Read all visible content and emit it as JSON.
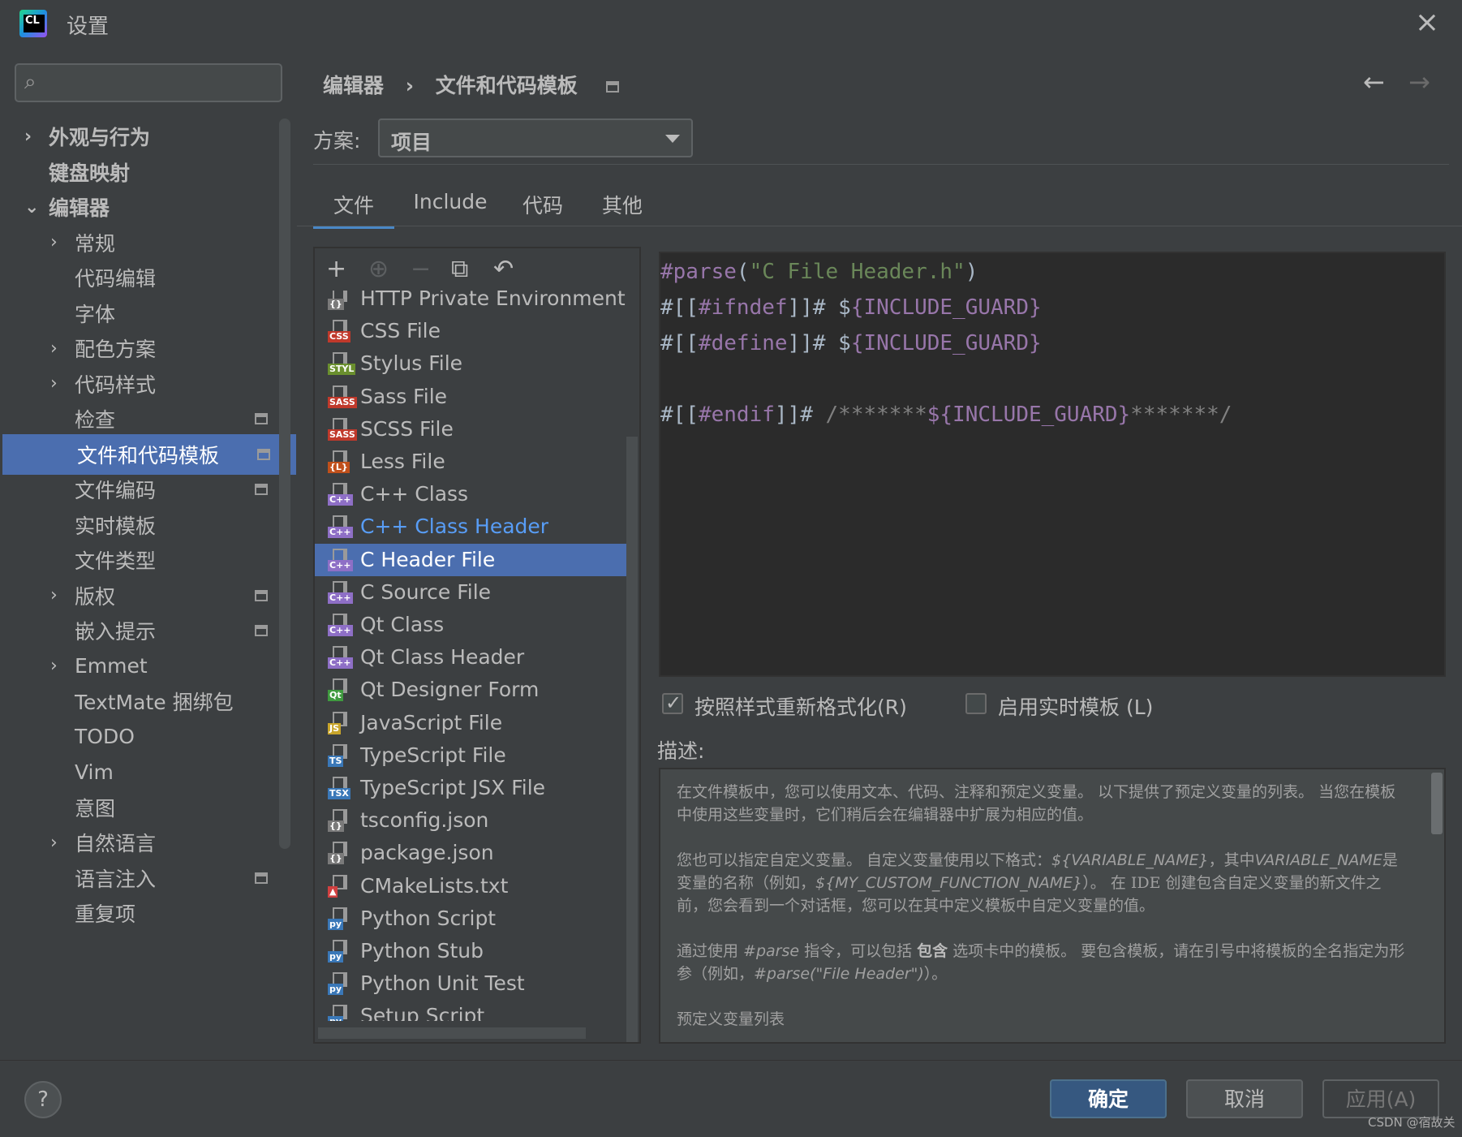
{
  "window": {
    "title": "设置",
    "close_icon": "×"
  },
  "search": {
    "placeholder": ""
  },
  "sidebar": {
    "items": [
      {
        "label": "外观与行为",
        "arrow": "›",
        "bold": true
      },
      {
        "label": "键盘映射",
        "arrow": "",
        "bold": true
      },
      {
        "label": "编辑器",
        "arrow": "⌄",
        "bold": true
      },
      {
        "label": "常规",
        "arrow": "›"
      },
      {
        "label": "代码编辑",
        "arrow": ""
      },
      {
        "label": "字体",
        "arrow": ""
      },
      {
        "label": "配色方案",
        "arrow": "›"
      },
      {
        "label": "代码样式",
        "arrow": "›"
      },
      {
        "label": "检查",
        "arrow": ""
      },
      {
        "label": "文件和代码模板",
        "arrow": ""
      },
      {
        "label": "文件编码",
        "arrow": ""
      },
      {
        "label": "实时模板",
        "arrow": ""
      },
      {
        "label": "文件类型",
        "arrow": ""
      },
      {
        "label": "版权",
        "arrow": "›"
      },
      {
        "label": "嵌入提示",
        "arrow": ""
      },
      {
        "label": "Emmet",
        "arrow": "›"
      },
      {
        "label": "TextMate 捆绑包",
        "arrow": ""
      },
      {
        "label": "TODO",
        "arrow": ""
      },
      {
        "label": "Vim",
        "arrow": ""
      },
      {
        "label": "意图",
        "arrow": ""
      },
      {
        "label": "自然语言",
        "arrow": "›"
      },
      {
        "label": "语言注入",
        "arrow": ""
      },
      {
        "label": "重复项",
        "arrow": ""
      }
    ]
  },
  "breadcrumb": {
    "parent": "编辑器",
    "separator": "›",
    "current": "文件和代码模板"
  },
  "nav": {
    "back": "←",
    "forward": "→"
  },
  "scheme": {
    "label": "方案:",
    "value": "项目"
  },
  "tabs": [
    "文件",
    "Include",
    "代码",
    "其他"
  ],
  "toolbar": {
    "add": "+",
    "add_child": "⊕",
    "remove": "−",
    "copy": "⧉",
    "reset": "↶"
  },
  "files": [
    {
      "name": "HTTP Private Environment File",
      "badge": "{}",
      "color": "#7a7a7a"
    },
    {
      "name": "CSS File",
      "badge": "CSS",
      "color": "#c0392b"
    },
    {
      "name": "Stylus File",
      "badge": "STYL",
      "color": "#6a8f2e"
    },
    {
      "name": "Sass File",
      "badge": "SASS",
      "color": "#c0392b"
    },
    {
      "name": "SCSS File",
      "badge": "SASS",
      "color": "#c0392b"
    },
    {
      "name": "Less File",
      "badge": "{L}",
      "color": "#c0501b"
    },
    {
      "name": "C++ Class",
      "badge": "C++",
      "color": "#8e6fc6"
    },
    {
      "name": "C++ Class Header",
      "badge": "C++",
      "color": "#8e6fc6"
    },
    {
      "name": "C Header File",
      "badge": "C++",
      "color": "#8e6fc6"
    },
    {
      "name": "C Source File",
      "badge": "C++",
      "color": "#8e6fc6"
    },
    {
      "name": "Qt Class",
      "badge": "C++",
      "color": "#8e6fc6"
    },
    {
      "name": "Qt Class Header",
      "badge": "C++",
      "color": "#8e6fc6"
    },
    {
      "name": "Qt Designer Form",
      "badge": "Qt",
      "color": "#3f9a3f"
    },
    {
      "name": "JavaScript File",
      "badge": "JS",
      "color": "#c8a52b"
    },
    {
      "name": "TypeScript File",
      "badge": "TS",
      "color": "#3a78b8"
    },
    {
      "name": "TypeScript JSX File",
      "badge": "TSX",
      "color": "#3a78b8"
    },
    {
      "name": "tsconfig.json",
      "badge": "{}",
      "color": "#7a7a7a"
    },
    {
      "name": "package.json",
      "badge": "{}",
      "color": "#7a7a7a"
    },
    {
      "name": "CMakeLists.txt",
      "badge": "▲",
      "color": "#d04040"
    },
    {
      "name": "Python Script",
      "badge": "py",
      "color": "#3a78b8"
    },
    {
      "name": "Python Stub",
      "badge": "py",
      "color": "#3a78b8"
    },
    {
      "name": "Python Unit Test",
      "badge": "py",
      "color": "#3a78b8"
    },
    {
      "name": "Setup Script",
      "badge": "py",
      "color": "#3a78b8"
    }
  ],
  "editor": {
    "lines": [
      "#parse(\"C File Header.h\")",
      "#[[#ifndef]]# ${INCLUDE_GUARD}",
      "#[[#define]]# ${INCLUDE_GUARD}",
      "",
      "#[[#endif]]# /*******${INCLUDE_GUARD}*******/"
    ]
  },
  "options": {
    "reformat_label": "按照样式重新格式化(R)",
    "reformat_checked": true,
    "live_template_label": "启用实时模板 (L)",
    "live_template_checked": false
  },
  "description": {
    "title": "描述:",
    "p1": "在文件模板中，您可以使用文本、代码、注释和预定义变量。 以下提供了预定义变量的列表。 当您在模板中使用这些变量时，它们稍后会在编辑器中扩展为相应的值。",
    "p2a": "您也可以指定自定义变量。 自定义变量使用以下格式：",
    "p2b": "${VARIABLE_NAME}",
    "p2c": "，其中",
    "p2d": "VARIABLE_NAME",
    "p2e": "是变量的名称（例如，",
    "p2f": "${MY_CUSTOM_FUNCTION_NAME}",
    "p2g": "）。 在 IDE 创建包含自定义变量的新文件之前，您会看到一个对话框，您可以在其中定义模板中自定义变量的值。",
    "p3a": "通过使用 ",
    "p3b": "#parse",
    "p3c": " 指令，可以包括 ",
    "p3d": "包含",
    "p3e": " 选项卡中的模板。 要包含模板，请在引号中将模板的全名指定为形参（例如，",
    "p3f": "#parse(\"File Header\")",
    "p3g": "）。",
    "p4": "预定义变量列表"
  },
  "footer": {
    "help": "?",
    "ok": "确定",
    "cancel": "取消",
    "apply": "应用(A)"
  },
  "watermark": "CSDN @宿故关"
}
